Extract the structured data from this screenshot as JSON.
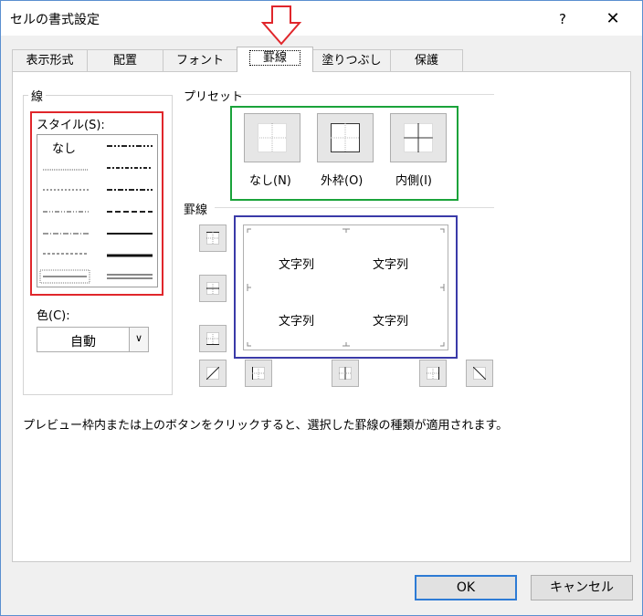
{
  "window": {
    "title": "セルの書式設定",
    "help": "?",
    "close": "✕"
  },
  "tabs": [
    {
      "label": "表示形式"
    },
    {
      "label": "配置"
    },
    {
      "label": "フォント"
    },
    {
      "label": "罫線",
      "active": true
    },
    {
      "label": "塗りつぶし"
    },
    {
      "label": "保護"
    }
  ],
  "line": {
    "group_label": "線",
    "style_label": "スタイル(S):",
    "none_label": "なし",
    "color_label": "色(C):",
    "color_value": "自動"
  },
  "presets": {
    "group_label": "プリセット",
    "items": [
      {
        "label": "なし(N)"
      },
      {
        "label": "外枠(O)"
      },
      {
        "label": "内側(I)"
      }
    ]
  },
  "border": {
    "group_label": "罫線",
    "preview_texts": [
      "文字列",
      "文字列",
      "文字列",
      "文字列"
    ]
  },
  "hint": "プレビュー枠内または上のボタンをクリックすると、選択した罫線の種類が適用されます。",
  "buttons": {
    "ok": "OK",
    "cancel": "キャンセル"
  },
  "colors": {
    "red": "#e0262b",
    "green": "#1aa33a",
    "blue": "#3a3aa8",
    "arrow": "#e0262b",
    "ok_border": "#2d7bd5"
  }
}
